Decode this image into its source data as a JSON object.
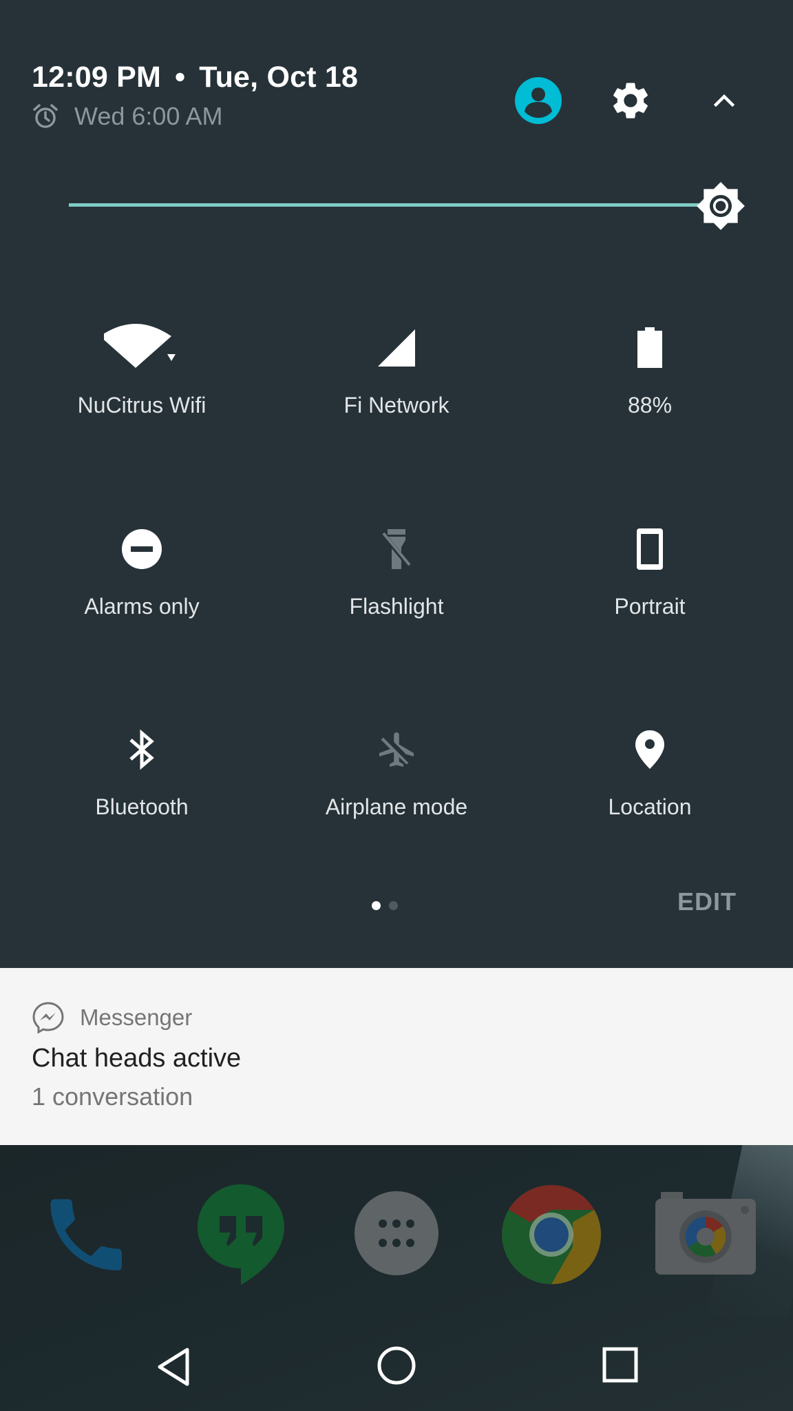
{
  "status": {
    "time": "12:09 PM",
    "separator": "•",
    "date": "Tue, Oct 18",
    "alarm": "Wed 6:00 AM"
  },
  "header_icons": [
    "user-account-icon",
    "settings-gear-icon",
    "collapse-chevron-icon"
  ],
  "brightness": {
    "level": 1.0,
    "mode_icon": "brightness-icon"
  },
  "tiles": [
    {
      "label": "NuCitrus Wifi",
      "icon": "wifi-icon",
      "active": true
    },
    {
      "label": "Fi Network",
      "icon": "cell-signal-icon",
      "active": true
    },
    {
      "label": "88%",
      "icon": "battery-icon",
      "active": true
    },
    {
      "label": "Alarms only",
      "icon": "do-not-disturb-icon",
      "active": true
    },
    {
      "label": "Flashlight",
      "icon": "flashlight-off-icon",
      "active": false
    },
    {
      "label": "Portrait",
      "icon": "portrait-rotation-icon",
      "active": true
    },
    {
      "label": "Bluetooth",
      "icon": "bluetooth-icon",
      "active": true
    },
    {
      "label": "Airplane mode",
      "icon": "airplane-off-icon",
      "active": false
    },
    {
      "label": "Location",
      "icon": "location-pin-icon",
      "active": true
    }
  ],
  "pager": {
    "pages": 2,
    "current": 1
  },
  "edit_label": "EDIT",
  "notification": {
    "app": "Messenger",
    "title": "Chat heads active",
    "text": "1 conversation"
  },
  "dock": [
    "phone-app-icon",
    "hangouts-app-icon",
    "app-drawer-icon",
    "chrome-app-icon",
    "camera-app-icon"
  ],
  "navbar": [
    "back-icon",
    "home-icon",
    "recents-icon"
  ],
  "colors": {
    "panel_bg": "#263238",
    "accent": "#80cbc4",
    "user_icon": "#00bcd4",
    "notification_bg": "#f5f5f5",
    "dim_text": "#8e979c"
  }
}
